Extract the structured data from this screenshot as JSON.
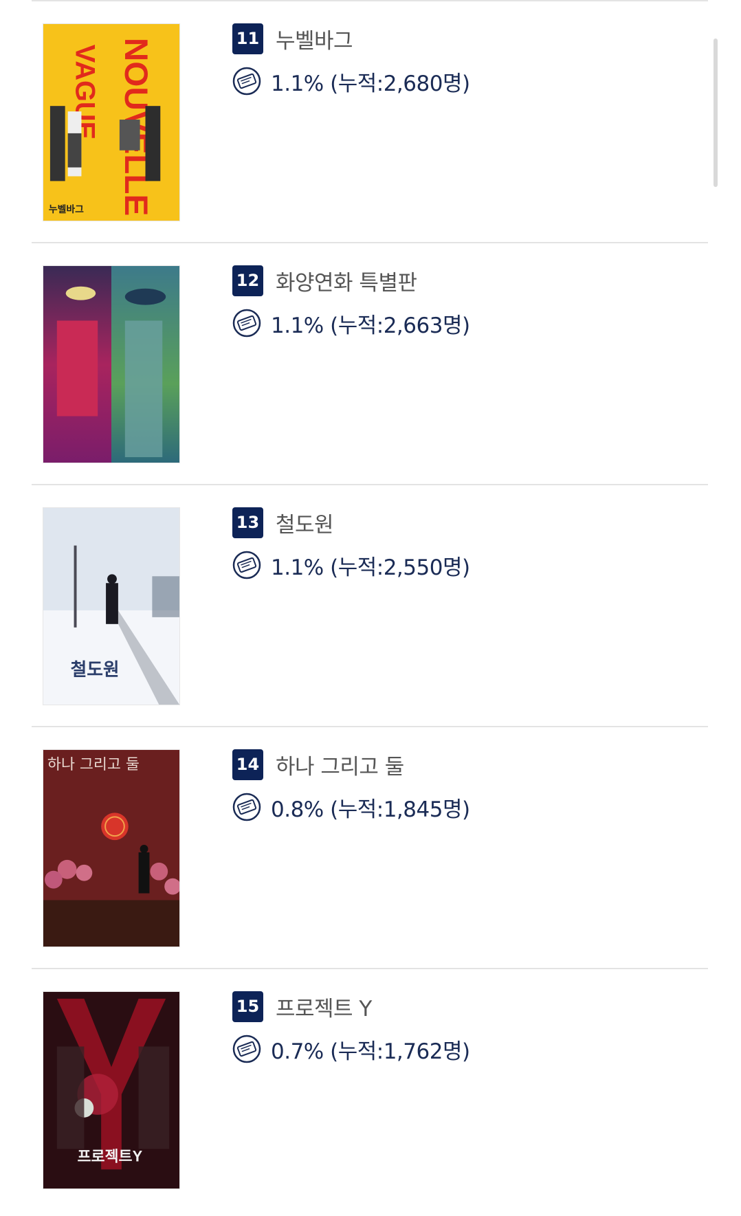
{
  "list": {
    "items": [
      {
        "rank": "11",
        "title": "누벨바그",
        "share": "1.1%",
        "cumulative": "(누적:2,680명)",
        "poster_icon": "poster-nouvelle-vague",
        "poster_text_top": "NOUVELLE",
        "poster_text_bottom": "VAGUE",
        "poster_title_ko": "누벨바그"
      },
      {
        "rank": "12",
        "title": "화양연화 특별판",
        "share": "1.1%",
        "cumulative": "(누적:2,663명)",
        "poster_icon": "poster-in-the-mood-for-love"
      },
      {
        "rank": "13",
        "title": "철도원",
        "share": "1.1%",
        "cumulative": "(누적:2,550명)",
        "poster_icon": "poster-railroad-man",
        "poster_title_ko": "철도원"
      },
      {
        "rank": "14",
        "title": "하나 그리고 둘",
        "share": "0.8%",
        "cumulative": "(누적:1,845명)",
        "poster_icon": "poster-yi-yi",
        "poster_title_ko": "하나 그리고 둘"
      },
      {
        "rank": "15",
        "title": "프로젝트 Y",
        "share": "0.7%",
        "cumulative": "(누적:1,762명)",
        "poster_icon": "poster-project-y",
        "poster_title_ko": "프로젝트Y"
      }
    ]
  },
  "colors": {
    "rank_badge": "#0d2357",
    "stat_text": "#1a2b55",
    "title_text": "#555555",
    "divider": "#e3e3e3"
  },
  "icons": {
    "stat_icon": "ticket-icon"
  }
}
